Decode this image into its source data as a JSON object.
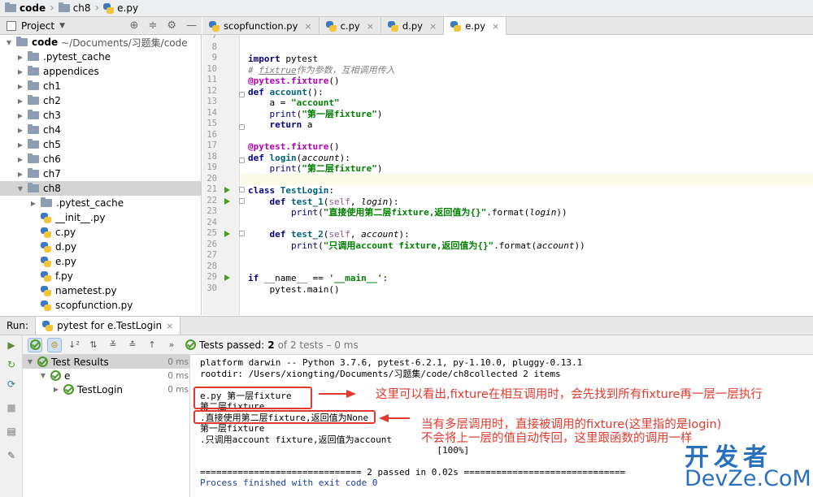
{
  "breadcrumb": [
    "code",
    "ch8",
    "e.py"
  ],
  "project_panel": {
    "title": "Project",
    "root_name": "code",
    "root_path": "~/Documents/习题集/code",
    "items": [
      {
        "label": ".pytest_cache",
        "type": "folder",
        "depth": 1
      },
      {
        "label": "appendices",
        "type": "folder",
        "depth": 1
      },
      {
        "label": "ch1",
        "type": "folder",
        "depth": 1
      },
      {
        "label": "ch2",
        "type": "folder",
        "depth": 1
      },
      {
        "label": "ch3",
        "type": "folder",
        "depth": 1
      },
      {
        "label": "ch4",
        "type": "folder",
        "depth": 1
      },
      {
        "label": "ch5",
        "type": "folder",
        "depth": 1
      },
      {
        "label": "ch6",
        "type": "folder",
        "depth": 1
      },
      {
        "label": "ch7",
        "type": "folder",
        "depth": 1
      },
      {
        "label": "ch8",
        "type": "folder",
        "depth": 1
      },
      {
        "label": ".pytest_cache",
        "type": "folder",
        "depth": 2
      },
      {
        "label": "__init__.py",
        "type": "py",
        "depth": 2
      },
      {
        "label": "c.py",
        "type": "py",
        "depth": 2
      },
      {
        "label": "d.py",
        "type": "py",
        "depth": 2
      },
      {
        "label": "e.py",
        "type": "py",
        "depth": 2
      },
      {
        "label": "f.py",
        "type": "py",
        "depth": 2
      },
      {
        "label": "nametest.py",
        "type": "py",
        "depth": 2
      },
      {
        "label": "scopfunction.py",
        "type": "py",
        "depth": 2
      }
    ]
  },
  "tabs": [
    {
      "label": "scopfunction.py",
      "active": false
    },
    {
      "label": "c.py",
      "active": false
    },
    {
      "label": "d.py",
      "active": false
    },
    {
      "label": "e.py",
      "active": true
    }
  ],
  "editor": {
    "line_numbers": [
      "7",
      "8",
      "9",
      "10",
      "11",
      "12",
      "13",
      "14",
      "15",
      "16",
      "17",
      "18",
      "19",
      "20",
      "21",
      "22",
      "23",
      "24",
      "25",
      "26",
      "27",
      "28",
      "29",
      "30"
    ],
    "code": {
      "l9_kw": "import",
      "l9_rest": " pytest",
      "l10_cmt_a": "# ",
      "l10_cmt_b": "fixtrue",
      "l10_cmt_c": "作为参数，互相调用传入",
      "l11_dec": "@pytest.fixture",
      "l11_rest": "()",
      "l12_kw": "def",
      "l12_fn": " account",
      "l12_rest": "():",
      "l13_a": "    a = ",
      "l13_str": "\"account\"",
      "l14_a": "    ",
      "l14_print": "print",
      "l14_b": "(",
      "l14_str": "\"第一层fixture\"",
      "l14_c": ")",
      "l15_a": "    ",
      "l15_kw": "return",
      "l15_b": " a",
      "l17_dec": "@pytest.fixture",
      "l17_rest": "()",
      "l18_kw": "def",
      "l18_fn": " login",
      "l18_b": "(",
      "l18_param": "account",
      "l18_c": "):",
      "l19_a": "    ",
      "l19_print": "print",
      "l19_b": "(",
      "l19_str": "\"第二层fixture\"",
      "l19_c": ")",
      "l21_kw": "class",
      "l21_fn": " TestLogin",
      "l21_rest": ":",
      "l22_a": "    ",
      "l22_kw": "def",
      "l22_fn": " test_1",
      "l22_b": "(",
      "l22_self": "self",
      "l22_c": ", ",
      "l22_param": "login",
      "l22_d": "):",
      "l23_a": "        ",
      "l23_print": "print",
      "l23_b": "(",
      "l23_str": "\"直接使用第二层fixture,返回值为{}\"",
      "l23_c": ".format(",
      "l23_param": "login",
      "l23_d": "))",
      "l25_a": "    ",
      "l25_kw": "def",
      "l25_fn": " test_2",
      "l25_b": "(",
      "l25_self": "self",
      "l25_c": ", ",
      "l25_param": "account",
      "l25_d": "):",
      "l26_a": "        ",
      "l26_print": "print",
      "l26_b": "(",
      "l26_str": "\"只调用account fixture,返回值为{}\"",
      "l26_c": ".format(",
      "l26_param": "account",
      "l26_d": "))",
      "l29_kw": "if",
      "l29_b": " __name__ == ",
      "l29_str": "'__main__'",
      "l29_c": ":",
      "l30_a": "    pytest.main()"
    }
  },
  "run": {
    "label": "Run:",
    "config_name": "pytest for e.TestLogin",
    "status_prefix": "Tests passed:",
    "passed": "2",
    "status_suffix": "of 2 tests – 0 ms"
  },
  "results": [
    {
      "label": "Test Results",
      "time": "0 ms"
    },
    {
      "label": "e",
      "time": "0 ms"
    },
    {
      "label": "TestLogin",
      "time": "0 ms"
    }
  ],
  "console": [
    "platform darwin -- Python 3.7.6, pytest-6.2.1, py-1.10.0, pluggy-0.13.1",
    "rootdir: /Users/xiongting/Documents/习题集/code/ch8collected 2 items",
    "",
    "e.py 第一层fixture",
    "第二层fixture",
    ".直接使用第二层fixture,返回值为None",
    "第一层fixture",
    ".只调用account fixture,返回值为account",
    "                                            [100%]",
    "",
    "============================== 2 passed in 0.02s ==============================",
    "Process finished with exit code 0"
  ],
  "annotations": {
    "note1": "这里可以看出,fixture在相互调用时，会先找到所有fixture再一层一层执行",
    "note2_line1": "当有多层调用时，直接被调用的fixture(这里指的是login)",
    "note2_line2": "不会将上一层的值自动传回，这里跟函数的调用一样"
  },
  "watermark": {
    "cn": "开发者",
    "en": "DevZe.CoM"
  },
  "colors": {
    "keyword": "#000080",
    "string": "#008000",
    "decorator": "#b200b2",
    "annotation": "#e03a2e",
    "watermark": "#2b6fbf"
  }
}
